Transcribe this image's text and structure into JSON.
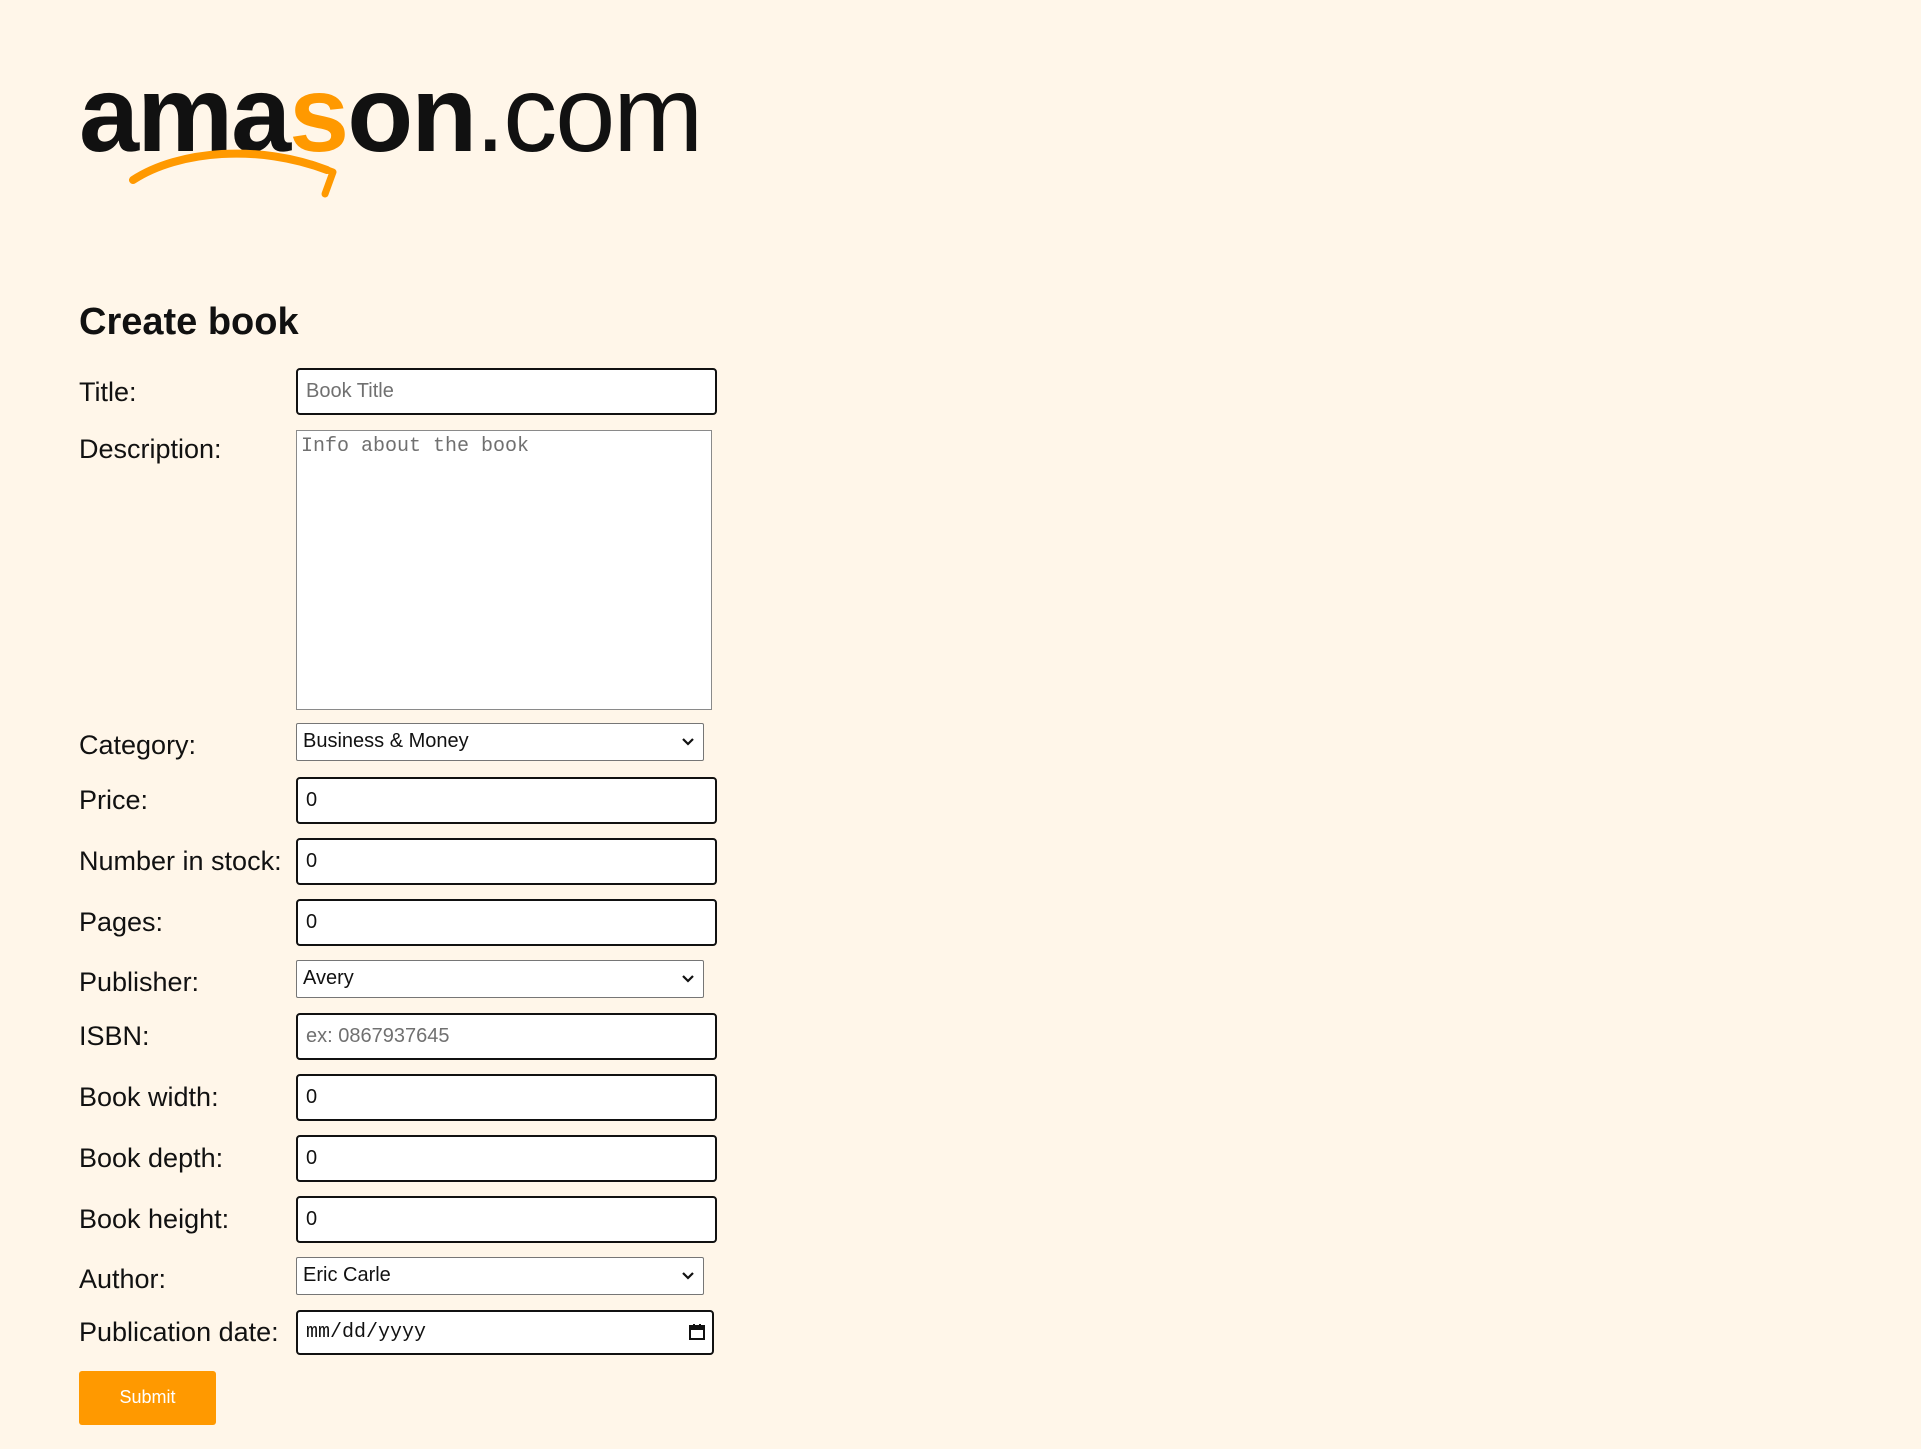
{
  "brand": {
    "logo_text_prefix": "ama",
    "logo_text_accent": "s",
    "logo_text_suffix": "on",
    "logo_text_dotcom": ".com",
    "accent_color": "#FF9900",
    "background_color": "#FFF6E9"
  },
  "page": {
    "title": "Create book"
  },
  "form": {
    "title": {
      "label": "Title:",
      "placeholder": "Book Title",
      "value": ""
    },
    "description": {
      "label": "Description:",
      "placeholder": "Info about the book",
      "value": ""
    },
    "category": {
      "label": "Category:",
      "selected": "Business & Money"
    },
    "price": {
      "label": "Price:",
      "value": "0"
    },
    "stock": {
      "label": "Number in stock:",
      "value": "0"
    },
    "pages": {
      "label": "Pages:",
      "value": "0"
    },
    "publisher": {
      "label": "Publisher:",
      "selected": "Avery"
    },
    "isbn": {
      "label": "ISBN:",
      "placeholder": "ex: 0867937645",
      "value": ""
    },
    "width": {
      "label": "Book width:",
      "value": "0"
    },
    "depth": {
      "label": "Book depth:",
      "value": "0"
    },
    "height": {
      "label": "Book height:",
      "value": "0"
    },
    "author": {
      "label": "Author:",
      "selected": "Eric Carle"
    },
    "publication_date": {
      "label": "Publication date:",
      "placeholder": "mm/dd/yyyy"
    },
    "submit_label": "Submit"
  },
  "icons": {
    "logo_smile": "smile-arrow-icon",
    "select_chevron": "chevron-down-icon",
    "date_picker": "calendar-icon"
  }
}
